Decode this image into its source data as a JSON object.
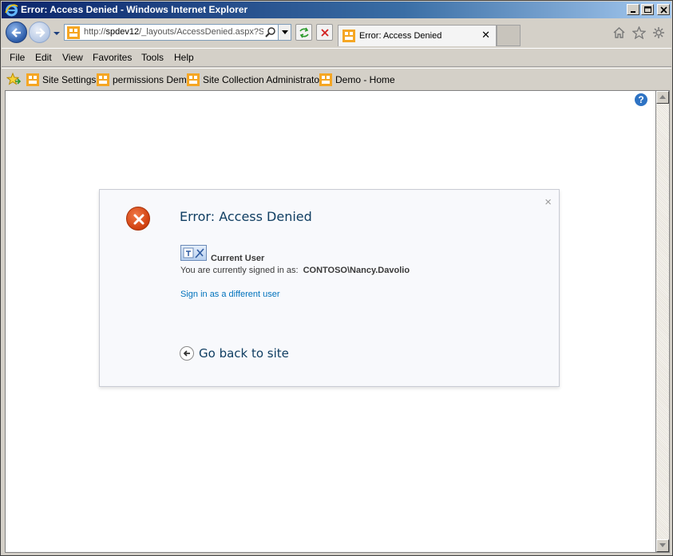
{
  "window": {
    "title": "Error: Access Denied - Windows Internet Explorer",
    "controls": {
      "minimize": "minimize",
      "maximize": "maximize",
      "close": "close"
    }
  },
  "address": {
    "url_prefix": "http://",
    "url_host": "spdev12",
    "url_path": "/_layouts/AccessDenied.aspx?S"
  },
  "tab": {
    "label": "Error: Access Denied",
    "close_glyph": "✕"
  },
  "menu": {
    "items": [
      "File",
      "Edit",
      "View",
      "Favorites",
      "Tools",
      "Help"
    ]
  },
  "favorites": {
    "items": [
      "Site Settings",
      "permissions Demo",
      "Site Collection Administrators",
      "Demo - Home"
    ]
  },
  "dialog": {
    "close_glyph": "×",
    "title": "Error: Access Denied",
    "current_user_label": "Current User",
    "signed_in_text": "You are currently signed in as:",
    "account": "CONTOSO\\Nancy.Davolio",
    "sign_in_link": "Sign in as a different user",
    "go_back": "Go back to site"
  },
  "help": {
    "glyph": "?"
  },
  "colors": {
    "title_text": "#103e62",
    "link": "#0072bc",
    "error_icon": "#d34413",
    "titlebar_start": "#0a246a"
  },
  "icons": [
    "ie-logo-icon",
    "back-arrow-icon",
    "forward-arrow-icon",
    "sharepoint-site-icon",
    "search-icon",
    "refresh-icon",
    "stop-icon",
    "home-icon",
    "favorites-star-icon",
    "gear-icon",
    "help-icon",
    "error-x-icon",
    "user-icon",
    "back-circle-icon"
  ]
}
